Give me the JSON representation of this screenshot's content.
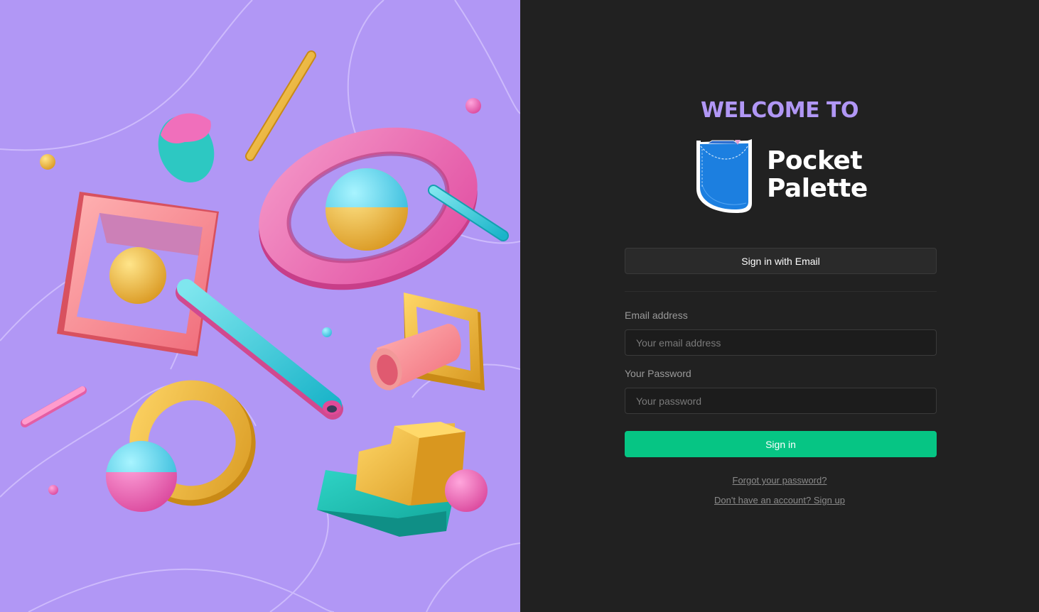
{
  "colors": {
    "accent_purple": "#b197f5",
    "sign_in_green": "#06c584",
    "background_dark": "#212121",
    "logo_blue": "#1c7fe0"
  },
  "welcome": {
    "heading": "WELCOME TO"
  },
  "brand": {
    "line1": "Pocket",
    "line2": "Palette",
    "logo_icon": "pocket-icon"
  },
  "auth": {
    "email_provider_button": "Sign in with Email",
    "email_label": "Email address",
    "email_placeholder": "Your email address",
    "email_value": "",
    "password_label": "Your Password",
    "password_placeholder": "Your password",
    "password_value": "",
    "submit_label": "Sign in",
    "forgot_link": "Forgot your password?",
    "signup_link": "Don't have an account? Sign up"
  },
  "illustration": {
    "name": "abstract-3d-shapes-illustration"
  }
}
